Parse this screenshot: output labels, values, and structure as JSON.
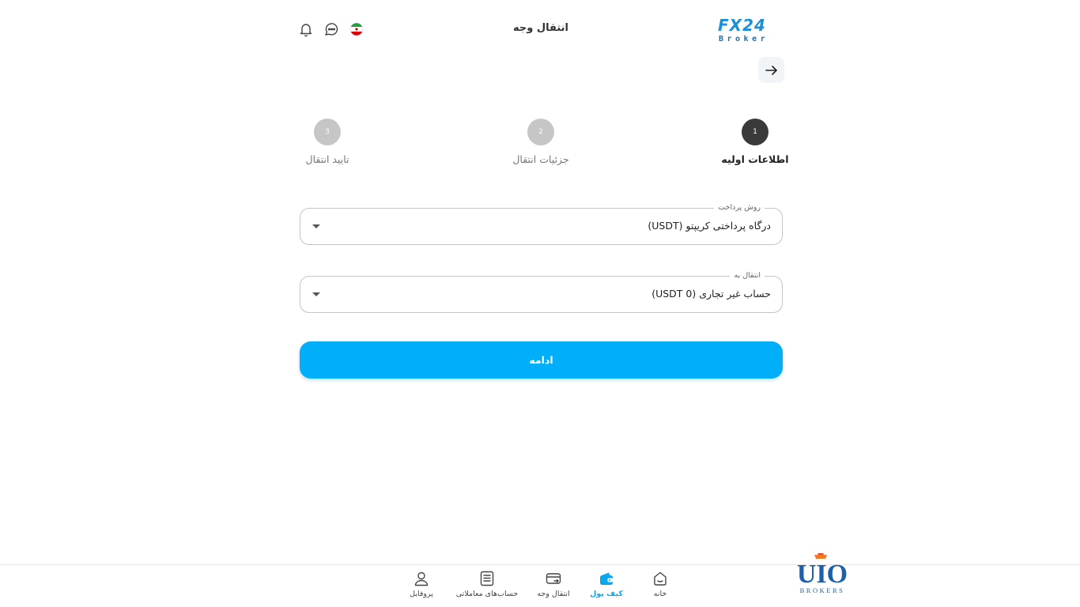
{
  "header": {
    "title": "انتقال وجه",
    "logo_main": "FX24",
    "logo_sub": "Broker"
  },
  "stepper": {
    "steps": [
      {
        "number": "1",
        "label": "اطلاعات اولیه",
        "state": "active"
      },
      {
        "number": "2",
        "label": "جزئیات انتقال",
        "state": "inactive"
      },
      {
        "number": "3",
        "label": "تایید انتقال",
        "state": "inactive"
      }
    ]
  },
  "form": {
    "payment_method": {
      "label": "روش پرداخت",
      "value": "درگاه پرداختی کریپتو (USDT)"
    },
    "transfer_to": {
      "label": "انتقال به",
      "value": "حساب غیر تجاری (USDT 0)"
    },
    "continue_label": "ادامه"
  },
  "bottom_nav": {
    "items": [
      {
        "label": "خانه",
        "icon": "home-icon",
        "active": false
      },
      {
        "label": "کیف پول",
        "icon": "wallet-icon",
        "active": true
      },
      {
        "label": "انتقال وجه",
        "icon": "transfer-icon",
        "active": false
      },
      {
        "label": "حساب‌های معاملاتی",
        "icon": "accounts-icon",
        "active": false
      },
      {
        "label": "پروفایل",
        "icon": "profile-icon",
        "active": false
      }
    ]
  },
  "brand_watermark": {
    "main": "UIO",
    "sub": "BROKERS"
  },
  "colors": {
    "accent": "#00aef9",
    "logo_blue": "#1c8fd6",
    "active_step": "#3a3a3a",
    "inactive_step": "#c6c6c6"
  }
}
